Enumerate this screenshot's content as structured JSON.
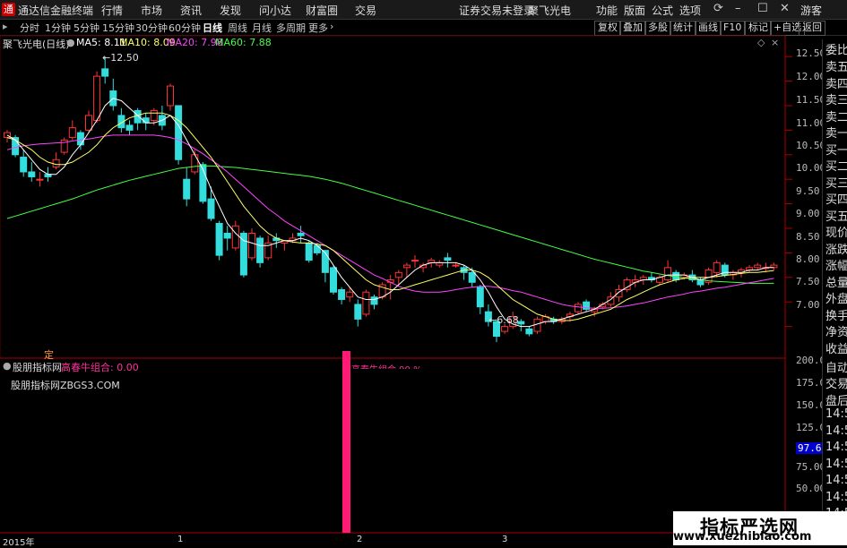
{
  "menubar": {
    "app_title": "通达信金融终端",
    "items": [
      "行情",
      "市场",
      "资讯",
      "发现",
      "问小达",
      "财富圈",
      "交易"
    ],
    "warning": "证券交易未登录",
    "stock": "聚飞光电",
    "right_items": [
      "功能",
      "版面",
      "公式",
      "选项"
    ],
    "guest": "游客"
  },
  "period_tabs": {
    "items": [
      "分时",
      "1分钟",
      "5分钟",
      "15分钟",
      "30分钟",
      "60分钟",
      "日线",
      "周线",
      "月线",
      "多周期",
      "更多"
    ],
    "active": "日线"
  },
  "right_toolbar": [
    "复权",
    "叠加",
    "多股",
    "统计",
    "画线",
    "F10",
    "标记",
    "+自选",
    "返回"
  ],
  "info": {
    "title": "聚飞光电(日线)",
    "ma5": "MA5: 8.11",
    "ma10": "MA10: 8.09",
    "ma20": "MA20: 7.98",
    "ma60": "MA60: 7.88",
    "colors": {
      "ma5": "#ffffff",
      "ma10": "#ffff66",
      "ma20": "#ff44ff",
      "ma60": "#44ff44"
    }
  },
  "sub_info": {
    "name": "股朋指标网",
    "indicator": "高春牛组合: 0.00",
    "watermark_text": "股朋指标网ZBGS3.COM",
    "signal_label": "定",
    "bar_annotation": "高春牛组合 90 %"
  },
  "right_panel": [
    "委比",
    "卖五",
    "卖四",
    "卖三",
    "卖二",
    "卖一",
    "买一",
    "买二",
    "买三",
    "买四",
    "买五",
    "现价",
    "涨跌",
    "涨幅",
    "总量",
    "外盘",
    "换手",
    "净资",
    "收益",
    "自动",
    "交易",
    "盘后",
    "14:56",
    "14:56",
    "14:56",
    "14:56",
    "14:56",
    "14:56",
    "14:56"
  ],
  "price_axis": [
    "12.50",
    "12.00",
    "11.50",
    "11.00",
    "10.50",
    "10.00",
    "9.50",
    "9.00",
    "8.50",
    "8.00",
    "7.50",
    "7.00"
  ],
  "sub_axis": [
    "200.0",
    "175.0",
    "150.0",
    "125.0",
    "100.0",
    "75.00",
    "50.00"
  ],
  "sub_current": "97.66",
  "x_axis": [
    "2015年",
    "1",
    "2",
    "3"
  ],
  "annotations": {
    "high": "12.50",
    "low": "6.68"
  },
  "watermark": {
    "title": "指标严选网",
    "url": "www.xuezhibiao.com"
  },
  "chart_data": {
    "type": "candlestick",
    "candles": [
      [
        10.85,
        11.0,
        10.75,
        10.95
      ],
      [
        10.85,
        10.9,
        10.45,
        10.5
      ],
      [
        10.45,
        10.6,
        10.05,
        10.15
      ],
      [
        10.15,
        10.35,
        9.95,
        10.05
      ],
      [
        10.0,
        10.15,
        9.85,
        10.0
      ],
      [
        10.1,
        10.25,
        9.95,
        10.05
      ],
      [
        10.25,
        10.55,
        10.2,
        10.4
      ],
      [
        10.55,
        10.85,
        10.5,
        10.8
      ],
      [
        10.85,
        11.2,
        10.8,
        11.05
      ],
      [
        10.95,
        11.0,
        10.6,
        10.7
      ],
      [
        11.0,
        11.4,
        10.95,
        11.3
      ],
      [
        11.2,
        12.2,
        11.15,
        12.1
      ],
      [
        12.25,
        12.5,
        11.95,
        12.1
      ],
      [
        11.8,
        12.05,
        11.4,
        11.5
      ],
      [
        11.3,
        11.45,
        10.95,
        11.05
      ],
      [
        11.1,
        11.2,
        10.9,
        11.0
      ],
      [
        11.4,
        11.45,
        11.0,
        11.15
      ],
      [
        11.25,
        11.35,
        11.0,
        11.15
      ],
      [
        11.2,
        11.45,
        11.1,
        11.4
      ],
      [
        11.3,
        11.5,
        11.0,
        11.1
      ],
      [
        11.5,
        11.95,
        11.4,
        11.9
      ],
      [
        11.5,
        11.5,
        10.3,
        10.4
      ],
      [
        10.0,
        10.25,
        9.45,
        9.6
      ],
      [
        10.15,
        10.6,
        10.1,
        10.5
      ],
      [
        10.3,
        10.35,
        9.5,
        9.55
      ],
      [
        9.6,
        9.85,
        9.15,
        9.2
      ],
      [
        9.1,
        9.15,
        8.35,
        8.45
      ],
      [
        8.9,
        9.05,
        8.55,
        8.8
      ],
      [
        8.6,
        9.15,
        8.55,
        9.05
      ],
      [
        8.9,
        8.95,
        8.0,
        8.05
      ],
      [
        8.4,
        9.0,
        8.35,
        8.9
      ],
      [
        8.8,
        8.85,
        8.2,
        8.3
      ],
      [
        8.4,
        8.85,
        8.35,
        8.7
      ],
      [
        8.8,
        8.9,
        8.6,
        8.75
      ],
      [
        8.7,
        8.75,
        8.55,
        8.75
      ],
      [
        8.75,
        8.9,
        8.7,
        8.8
      ],
      [
        8.9,
        9.05,
        8.7,
        8.85
      ],
      [
        8.7,
        8.75,
        8.3,
        8.35
      ],
      [
        8.65,
        8.7,
        8.45,
        8.5
      ],
      [
        8.55,
        8.55,
        7.9,
        8.1
      ],
      [
        8.2,
        8.25,
        7.65,
        7.7
      ],
      [
        7.75,
        7.8,
        7.45,
        7.55
      ],
      [
        7.6,
        7.8,
        7.5,
        7.7
      ],
      [
        7.45,
        7.55,
        7.0,
        7.15
      ],
      [
        7.25,
        7.75,
        7.2,
        7.7
      ],
      [
        7.6,
        7.65,
        7.35,
        7.45
      ],
      [
        7.6,
        7.9,
        7.55,
        7.85
      ],
      [
        7.9,
        8.05,
        7.55,
        7.95
      ],
      [
        8.0,
        8.15,
        7.85,
        8.1
      ],
      [
        8.2,
        8.3,
        8.0,
        8.25
      ],
      [
        8.35,
        8.45,
        8.2,
        8.35
      ],
      [
        8.2,
        8.3,
        8.1,
        8.25
      ],
      [
        8.3,
        8.4,
        8.2,
        8.35
      ],
      [
        8.25,
        8.35,
        8.2,
        8.3
      ],
      [
        8.4,
        8.5,
        8.2,
        8.35
      ],
      [
        8.25,
        8.3,
        8.2,
        8.25
      ],
      [
        8.2,
        8.25,
        7.95,
        8.1
      ],
      [
        8.1,
        8.2,
        7.8,
        7.9
      ],
      [
        7.8,
        7.85,
        7.25,
        7.4
      ],
      [
        7.3,
        7.45,
        7.0,
        7.1
      ],
      [
        7.1,
        7.15,
        6.68,
        6.8
      ],
      [
        6.9,
        7.05,
        6.85,
        7.0
      ],
      [
        7.0,
        7.3,
        6.95,
        7.2
      ],
      [
        7.1,
        7.15,
        6.9,
        7.05
      ],
      [
        6.95,
        7.0,
        6.8,
        6.85
      ],
      [
        6.9,
        7.2,
        6.85,
        7.15
      ],
      [
        7.1,
        7.25,
        7.05,
        7.2
      ],
      [
        7.15,
        7.2,
        7.05,
        7.1
      ],
      [
        7.1,
        7.2,
        7.05,
        7.15
      ],
      [
        7.2,
        7.3,
        7.1,
        7.25
      ],
      [
        7.3,
        7.5,
        7.25,
        7.45
      ],
      [
        7.5,
        7.55,
        7.3,
        7.35
      ],
      [
        7.3,
        7.4,
        7.2,
        7.35
      ],
      [
        7.4,
        7.5,
        7.35,
        7.45
      ],
      [
        7.45,
        7.7,
        7.4,
        7.6
      ],
      [
        7.6,
        7.85,
        7.5,
        7.75
      ],
      [
        7.75,
        8.0,
        7.7,
        7.95
      ],
      [
        7.9,
        8.05,
        7.8,
        7.95
      ],
      [
        7.95,
        8.05,
        7.85,
        8.0
      ],
      [
        8.0,
        8.1,
        7.9,
        7.95
      ],
      [
        7.9,
        8.05,
        7.85,
        8.0
      ],
      [
        7.95,
        8.35,
        7.9,
        8.2
      ],
      [
        8.1,
        8.15,
        7.9,
        7.95
      ],
      [
        8.0,
        8.1,
        7.95,
        8.05
      ],
      [
        8.05,
        8.15,
        7.9,
        7.95
      ],
      [
        7.95,
        8.0,
        7.8,
        7.85
      ],
      [
        7.9,
        8.2,
        7.85,
        8.15
      ],
      [
        8.1,
        8.35,
        8.0,
        8.3
      ],
      [
        8.25,
        8.3,
        8.0,
        8.05
      ],
      [
        8.05,
        8.15,
        7.95,
        8.1
      ],
      [
        8.1,
        8.2,
        8.0,
        8.15
      ],
      [
        8.15,
        8.25,
        8.1,
        8.2
      ],
      [
        8.2,
        8.3,
        8.15,
        8.25
      ],
      [
        8.2,
        8.3,
        8.1,
        8.2
      ],
      [
        8.2,
        8.3,
        8.15,
        8.25
      ]
    ],
    "ma5": [
      10.9,
      10.8,
      10.6,
      10.4,
      10.2,
      10.1,
      10.1,
      10.25,
      10.5,
      10.7,
      10.95,
      11.2,
      11.5,
      11.65,
      11.6,
      11.45,
      11.3,
      11.15,
      11.15,
      11.2,
      11.3,
      11.1,
      10.8,
      10.5,
      10.2,
      9.8,
      9.45,
      9.1,
      8.9,
      8.75,
      8.7,
      8.65,
      8.65,
      8.7,
      8.75,
      8.75,
      8.8,
      8.75,
      8.65,
      8.5,
      8.25,
      8.0,
      7.8,
      7.6,
      7.55,
      7.55,
      7.6,
      7.7,
      7.85,
      8.0,
      8.15,
      8.25,
      8.3,
      8.3,
      8.3,
      8.3,
      8.25,
      8.15,
      7.95,
      7.7,
      7.4,
      7.15,
      7.05,
      7.0,
      7.0,
      7.05,
      7.1,
      7.1,
      7.15,
      7.2,
      7.25,
      7.3,
      7.35,
      7.45,
      7.55,
      7.7,
      7.8,
      7.9,
      7.95,
      7.95,
      8.0,
      8.05,
      8.05,
      8.05,
      8.0,
      7.95,
      8.0,
      8.05,
      8.1,
      8.1,
      8.1,
      8.15,
      8.15,
      8.2,
      8.2
    ],
    "ma10": [
      10.85,
      10.8,
      10.7,
      10.6,
      10.45,
      10.35,
      10.3,
      10.3,
      10.35,
      10.45,
      10.55,
      10.7,
      10.9,
      11.05,
      11.15,
      11.25,
      11.3,
      11.35,
      11.35,
      11.35,
      11.3,
      11.2,
      11.05,
      10.85,
      10.65,
      10.45,
      10.2,
      9.95,
      9.7,
      9.45,
      9.25,
      9.05,
      8.9,
      8.8,
      8.75,
      8.72,
      8.7,
      8.7,
      8.68,
      8.65,
      8.55,
      8.4,
      8.25,
      8.1,
      7.95,
      7.85,
      7.8,
      7.75,
      7.75,
      7.8,
      7.85,
      7.9,
      7.95,
      8.0,
      8.05,
      8.1,
      8.15,
      8.15,
      8.1,
      8.0,
      7.85,
      7.7,
      7.55,
      7.45,
      7.35,
      7.25,
      7.2,
      7.15,
      7.12,
      7.12,
      7.15,
      7.2,
      7.25,
      7.3,
      7.35,
      7.45,
      7.55,
      7.62,
      7.7,
      7.78,
      7.85,
      7.9,
      7.95,
      7.98,
      8.0,
      8.0,
      8.0,
      8.02,
      8.04,
      8.06,
      8.08,
      8.1,
      8.1,
      8.12,
      8.14
    ],
    "ma20": [
      10.6,
      10.65,
      10.68,
      10.7,
      10.72,
      10.73,
      10.74,
      10.75,
      10.78,
      10.8,
      10.82,
      10.85,
      10.88,
      10.9,
      10.9,
      10.9,
      10.9,
      10.9,
      10.9,
      10.88,
      10.85,
      10.8,
      10.72,
      10.62,
      10.52,
      10.4,
      10.28,
      10.15,
      10.0,
      9.85,
      9.7,
      9.55,
      9.4,
      9.28,
      9.15,
      9.05,
      8.95,
      8.85,
      8.75,
      8.65,
      8.55,
      8.45,
      8.35,
      8.25,
      8.15,
      8.05,
      7.98,
      7.9,
      7.82,
      7.76,
      7.72,
      7.7,
      7.7,
      7.7,
      7.72,
      7.75,
      7.78,
      7.8,
      7.82,
      7.82,
      7.8,
      7.77,
      7.73,
      7.7,
      7.65,
      7.6,
      7.55,
      7.5,
      7.45,
      7.42,
      7.4,
      7.38,
      7.37,
      7.37,
      7.38,
      7.4,
      7.42,
      7.45,
      7.48,
      7.52,
      7.56,
      7.6,
      7.63,
      7.66,
      7.7,
      7.72,
      7.75,
      7.78,
      7.8,
      7.83,
      7.86,
      7.89,
      7.92,
      7.95,
      7.98
    ],
    "ma60": [
      9.2,
      9.25,
      9.3,
      9.35,
      9.4,
      9.45,
      9.5,
      9.55,
      9.6,
      9.66,
      9.72,
      9.78,
      9.83,
      9.88,
      9.93,
      9.98,
      10.02,
      10.06,
      10.1,
      10.14,
      10.18,
      10.22,
      10.24,
      10.26,
      10.27,
      10.27,
      10.26,
      10.25,
      10.24,
      10.22,
      10.2,
      10.18,
      10.16,
      10.14,
      10.12,
      10.1,
      10.08,
      10.06,
      10.03,
      10.0,
      9.96,
      9.92,
      9.87,
      9.82,
      9.77,
      9.72,
      9.67,
      9.62,
      9.57,
      9.52,
      9.47,
      9.42,
      9.37,
      9.32,
      9.27,
      9.22,
      9.17,
      9.12,
      9.07,
      9.02,
      8.97,
      8.92,
      8.87,
      8.82,
      8.77,
      8.72,
      8.67,
      8.62,
      8.57,
      8.52,
      8.47,
      8.42,
      8.37,
      8.33,
      8.29,
      8.25,
      8.21,
      8.17,
      8.13,
      8.1,
      8.07,
      8.04,
      8.01,
      7.99,
      7.97,
      7.95,
      7.93,
      7.92,
      7.91,
      7.9,
      7.89,
      7.88,
      7.88,
      7.88,
      7.88
    ],
    "price_range": [
      6.5,
      12.85
    ],
    "sub_bar": {
      "value": 210,
      "range": [
        0,
        210
      ]
    }
  }
}
